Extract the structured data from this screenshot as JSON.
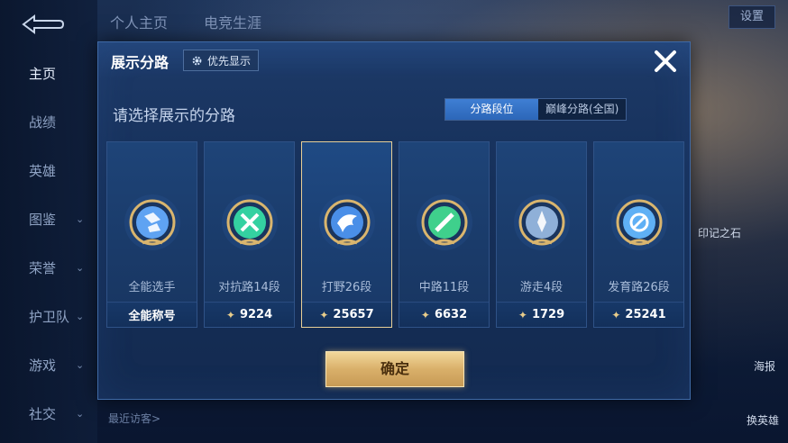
{
  "background": {
    "top_tabs": [
      "个人主页",
      "电竞生涯"
    ],
    "nav_items": [
      {
        "label": "主页",
        "active": true,
        "has_chevron": false
      },
      {
        "label": "战绩",
        "active": false,
        "has_chevron": false
      },
      {
        "label": "英雄",
        "active": false,
        "has_chevron": false
      },
      {
        "label": "图鉴",
        "active": false,
        "has_chevron": true
      },
      {
        "label": "荣誉",
        "active": false,
        "has_chevron": true
      },
      {
        "label": "护卫队",
        "active": false,
        "has_chevron": true
      },
      {
        "label": "游戏",
        "active": false,
        "has_chevron": true
      },
      {
        "label": "社交",
        "active": false,
        "has_chevron": true
      }
    ],
    "settings_label": "设置",
    "recent_visitors_label": "最近访客>",
    "side_labels": [
      "印记之石",
      "海报",
      "换英雄"
    ]
  },
  "modal": {
    "title": "展示分路",
    "priority_button": "优先显示",
    "subtitle": "请选择展示的分路",
    "segments": [
      {
        "label": "分路段位",
        "active": true
      },
      {
        "label": "巅峰分路(全国)",
        "active": false
      }
    ],
    "cards": [
      {
        "lane": "全能选手",
        "score": "全能称号",
        "show_diamond": false,
        "selected": false,
        "emblem": "all-round-emblem-icon",
        "color": "#5fa3f2"
      },
      {
        "lane": "对抗路14段",
        "score": "9224",
        "show_diamond": true,
        "selected": false,
        "emblem": "clash-lane-emblem-icon",
        "color": "#34d1a1"
      },
      {
        "lane": "打野26段",
        "score": "25657",
        "show_diamond": true,
        "selected": true,
        "emblem": "jungle-emblem-icon",
        "color": "#4a8fe8"
      },
      {
        "lane": "中路11段",
        "score": "6632",
        "show_diamond": true,
        "selected": false,
        "emblem": "mid-lane-emblem-icon",
        "color": "#3fd08c"
      },
      {
        "lane": "游走4段",
        "score": "1729",
        "show_diamond": true,
        "selected": false,
        "emblem": "roam-emblem-icon",
        "color": "#8fb0d8"
      },
      {
        "lane": "发育路26段",
        "score": "25241",
        "show_diamond": true,
        "selected": false,
        "emblem": "farm-lane-emblem-icon",
        "color": "#5fb0f5"
      }
    ],
    "confirm_label": "确定"
  },
  "colors": {
    "gold": "#e8cf97",
    "modal_bg": "#1a3b6a",
    "accent_blue": "#3f7fd4"
  }
}
